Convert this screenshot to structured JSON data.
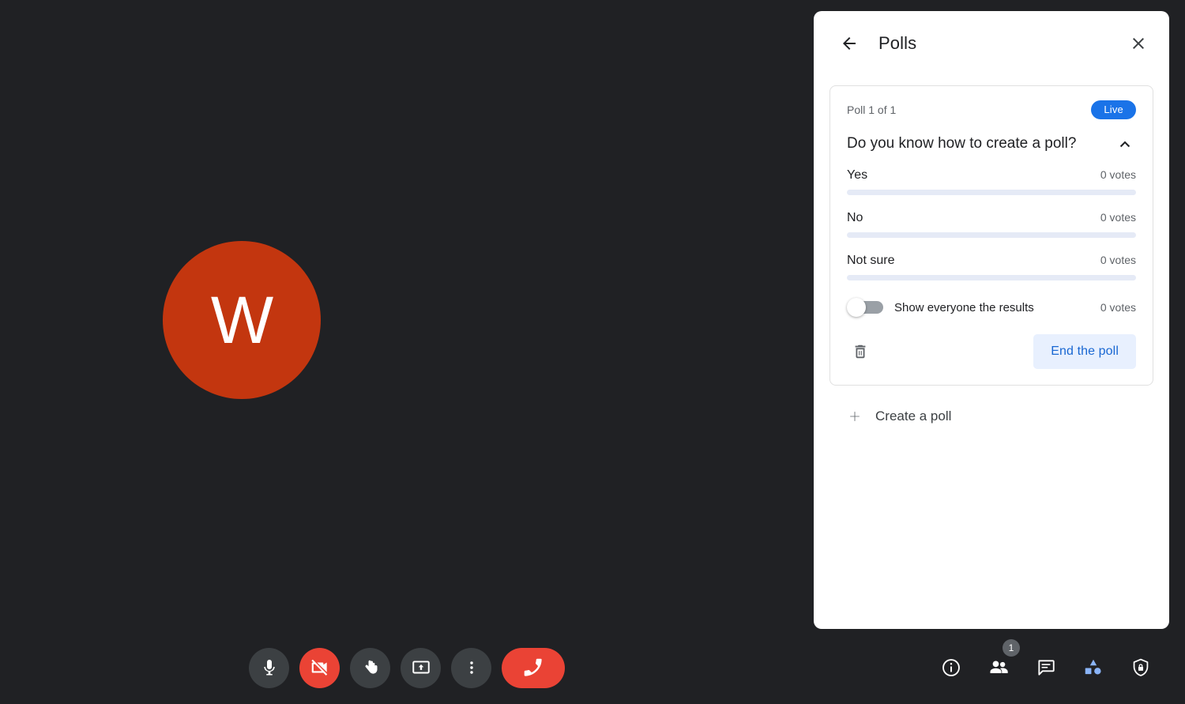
{
  "meeting": {
    "participant_avatar_initial": "W",
    "avatar_color": "#c3360f",
    "background_color": "#202124"
  },
  "panel": {
    "title": "Polls",
    "back_icon": "arrow-left-icon",
    "close_icon": "close-icon",
    "accent_color": "#1a73e8"
  },
  "poll": {
    "index_label": "Poll 1 of 1",
    "status_badge": "Live",
    "question": "Do you know how to create a poll?",
    "collapse_icon": "chevron-up-icon",
    "options": [
      {
        "label": "Yes",
        "votes_label": "0 votes",
        "percent": 0
      },
      {
        "label": "No",
        "votes_label": "0 votes",
        "percent": 0
      },
      {
        "label": "Not sure",
        "votes_label": "0 votes",
        "percent": 0
      }
    ],
    "show_results_toggle": {
      "label": "Show everyone the results",
      "state": "off",
      "total_votes_label": "0 votes"
    },
    "delete_icon": "trash-icon",
    "end_poll_label": "End the poll"
  },
  "create_poll": {
    "icon": "plus-icon",
    "label": "Create a poll"
  },
  "controls": [
    {
      "name": "microphone-button",
      "icon": "microphone-icon",
      "state": "on"
    },
    {
      "name": "camera-button",
      "icon": "camera-off-icon",
      "state": "off"
    },
    {
      "name": "raise-hand-button",
      "icon": "raised-hand-icon",
      "state": "off"
    },
    {
      "name": "present-screen-button",
      "icon": "present-screen-icon",
      "state": "off"
    },
    {
      "name": "more-options-button",
      "icon": "more-vertical-icon",
      "state": "off"
    },
    {
      "name": "leave-call-button",
      "icon": "hangup-phone-icon",
      "state": "danger"
    }
  ],
  "right_controls": [
    {
      "name": "meeting-details-button",
      "icon": "info-icon",
      "badge": ""
    },
    {
      "name": "participants-button",
      "icon": "people-icon",
      "badge": "1"
    },
    {
      "name": "chat-button",
      "icon": "chat-bubble-icon",
      "badge": ""
    },
    {
      "name": "activities-button",
      "icon": "activities-shapes-icon",
      "badge": ""
    },
    {
      "name": "host-controls-button",
      "icon": "shield-lock-icon",
      "badge": ""
    }
  ]
}
